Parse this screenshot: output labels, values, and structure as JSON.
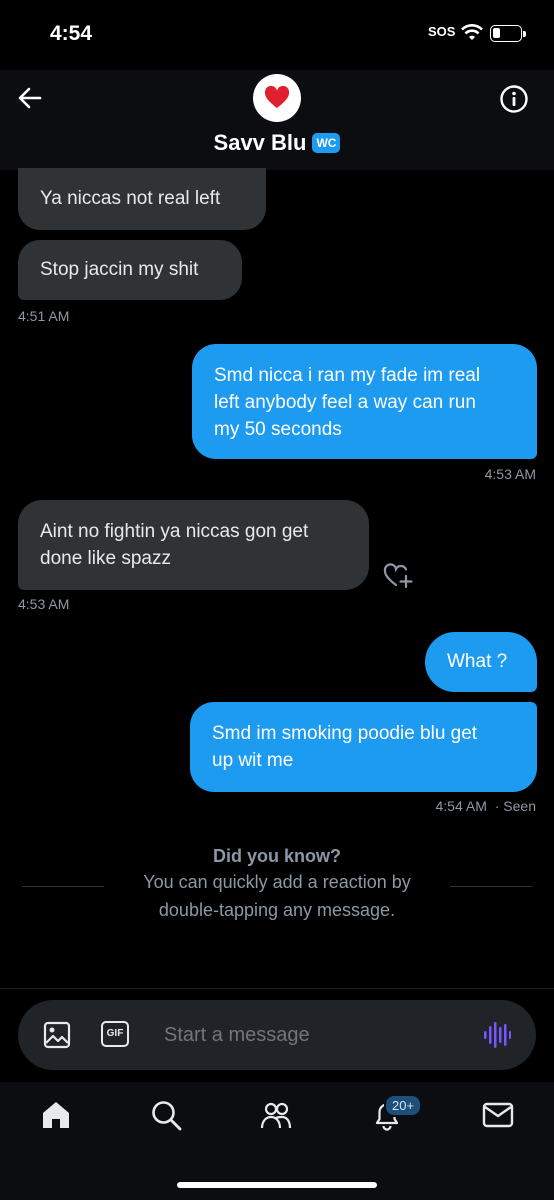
{
  "status_bar": {
    "time": "4:54",
    "sos": "SOS"
  },
  "header": {
    "name": "Savv Blu",
    "badge": "WC"
  },
  "messages": [
    {
      "text": "Ya niccas not real left"
    },
    {
      "text": "Stop jaccin my shit"
    },
    {
      "time": "4:51 AM"
    },
    {
      "text_lines": [
        "Smd nicca i ran my fade im real",
        "left anybody feel a way can run",
        "my 50 seconds"
      ],
      "time": "4:53 AM"
    },
    {
      "text_lines": [
        "Aint no fightin ya niccas gon get",
        "done like spazz"
      ],
      "time": "4:53 AM"
    },
    {
      "text": "What ?"
    },
    {
      "text_lines": [
        "Smd im smoking poodie blu get",
        "up wit me"
      ],
      "time": "4:54 AM",
      "status": "· Seen"
    }
  ],
  "tip": {
    "title": "Did you know?",
    "line1": "You can quickly add a reaction by",
    "line2": "double-tapping any message."
  },
  "composer": {
    "placeholder": "Start a message",
    "gif_label": "GIF"
  },
  "tabbar": {
    "notifications_badge": "20+"
  }
}
